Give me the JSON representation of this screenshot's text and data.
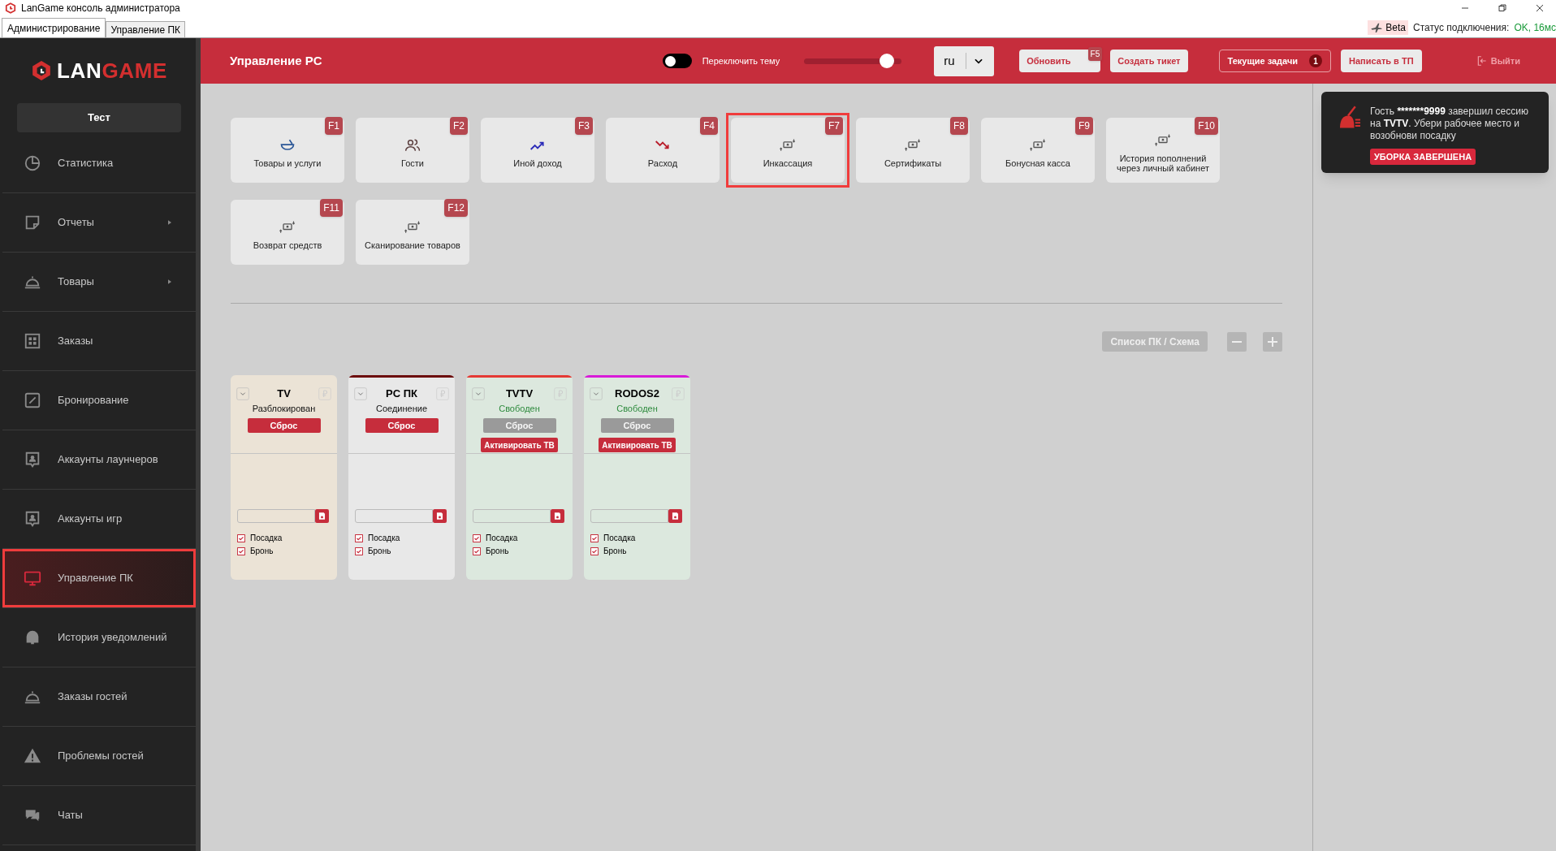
{
  "window": {
    "title": "LanGame консоль администратора"
  },
  "tabs": [
    {
      "label": "Администрирование",
      "selected": true
    },
    {
      "label": "Управление ПК",
      "selected": false
    }
  ],
  "status": {
    "beta": "Beta",
    "label": "Статус подключения:",
    "value": "OK, 16мс"
  },
  "sidebar": {
    "logo": {
      "part_1": "LAN",
      "part_2": "GAME"
    },
    "profile": "Тест",
    "items": [
      {
        "label": "Статистика",
        "submenu": false,
        "selected": false,
        "highlighted": false
      },
      {
        "label": "Отчеты",
        "submenu": true,
        "selected": false,
        "highlighted": false
      },
      {
        "label": "Товары",
        "submenu": true,
        "selected": false,
        "highlighted": false
      },
      {
        "label": "Заказы",
        "submenu": false,
        "selected": false,
        "highlighted": false
      },
      {
        "label": "Бронирование",
        "submenu": false,
        "selected": false,
        "highlighted": false
      },
      {
        "label": "Аккаунты лаунчеров",
        "submenu": false,
        "selected": false,
        "highlighted": false
      },
      {
        "label": "Аккаунты игр",
        "submenu": false,
        "selected": false,
        "highlighted": false
      },
      {
        "label": "Управление ПК",
        "submenu": false,
        "selected": true,
        "highlighted": true
      },
      {
        "label": "История уведомлений",
        "submenu": false,
        "selected": false,
        "highlighted": false
      },
      {
        "label": "Заказы гостей",
        "submenu": false,
        "selected": false,
        "highlighted": false
      },
      {
        "label": "Проблемы гостей",
        "submenu": false,
        "selected": false,
        "highlighted": false
      },
      {
        "label": "Чаты",
        "submenu": false,
        "selected": false,
        "highlighted": false
      }
    ]
  },
  "header": {
    "title": "Управление PC",
    "theme_toggle": {
      "label": "Переключить тему",
      "on": false
    },
    "slider": {
      "level": 0.85
    },
    "language": "ru",
    "refresh": {
      "label": "Обновить",
      "key": "F5"
    },
    "ticket": "Создать тикет",
    "tasks": {
      "label": "Текущие задачи",
      "count": "1"
    },
    "support": "Написать в ТП",
    "logout": "Выйти"
  },
  "actions": [
    {
      "label": "Товары и услуги",
      "key": "F1",
      "highlighted": false
    },
    {
      "label": "Гости",
      "key": "F2",
      "highlighted": false
    },
    {
      "label": "Иной доход",
      "key": "F3",
      "highlighted": false
    },
    {
      "label": "Расход",
      "key": "F4",
      "highlighted": false
    },
    {
      "label": "Инкассация",
      "key": "F7",
      "highlighted": true
    },
    {
      "label": "Сертификаты",
      "key": "F8",
      "highlighted": false
    },
    {
      "label": "Бонусная касса",
      "key": "F9",
      "highlighted": false
    },
    {
      "label": "История пополнений через личный кабинет",
      "key": "F10",
      "highlighted": false
    },
    {
      "label": "Возврат средств",
      "key": "F11",
      "highlighted": false
    },
    {
      "label": "Сканирование товаров",
      "key": "F12",
      "highlighted": false
    }
  ],
  "view_toggle": "Список ПК / Схема",
  "pcs": [
    {
      "name": "TV",
      "status": "Разблокирован",
      "kind": "unlocked",
      "reset": "Сброс",
      "reset_enabled": true,
      "seating": {
        "label": "Посадка",
        "checked": true
      },
      "booking": {
        "label": "Бронь",
        "checked": true
      }
    },
    {
      "name": "PC ПК",
      "status": "Соединение",
      "kind": "connecting",
      "color": "#6b0a0a",
      "reset": "Сброс",
      "reset_enabled": true,
      "seating": {
        "label": "Посадка",
        "checked": true
      },
      "booking": {
        "label": "Бронь",
        "checked": true
      }
    },
    {
      "name": "TVTV",
      "status": "Свободен",
      "kind": "free",
      "color": "#e53935",
      "reset": "Сброс",
      "reset_enabled": false,
      "activate": "Активировать ТВ",
      "seating": {
        "label": "Посадка",
        "checked": true
      },
      "booking": {
        "label": "Бронь",
        "checked": true
      }
    },
    {
      "name": "RODOS2",
      "status": "Свободен",
      "kind": "free",
      "color": "#d81bd8",
      "reset": "Сброс",
      "reset_enabled": false,
      "activate": "Активировать ТВ",
      "seating": {
        "label": "Посадка",
        "checked": true
      },
      "booking": {
        "label": "Бронь",
        "checked": true
      }
    }
  ],
  "notification": {
    "message": [
      {
        "text": "Гость ",
        "bold": false
      },
      {
        "text": "*******9999",
        "bold": true
      },
      {
        "text": " завершил сессию на ",
        "bold": false
      },
      {
        "text": "TVTV",
        "bold": true
      },
      {
        "text": ". Убери рабочее место и возобнови посадку",
        "bold": false
      }
    ],
    "action": "УБОРКА ЗАВЕРШЕНА"
  }
}
